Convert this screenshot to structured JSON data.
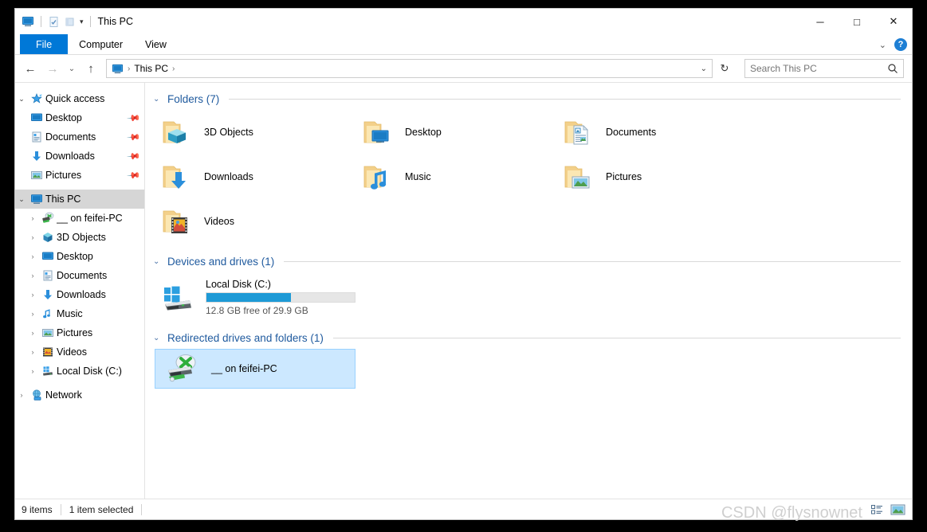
{
  "window": {
    "title": "This PC",
    "minimize_label": "─",
    "maximize_label": "□",
    "close_label": "✕"
  },
  "quick_access_toolbar": {
    "items": [
      {
        "name": "this-pc-icon",
        "label": ""
      },
      {
        "name": "properties-icon",
        "label": ""
      },
      {
        "name": "new-folder-icon",
        "label": ""
      },
      {
        "name": "customize-dropdown-icon",
        "label": "▾"
      }
    ]
  },
  "ribbon": {
    "tabs": [
      {
        "label": "File",
        "active": true
      },
      {
        "label": "Computer",
        "active": false
      },
      {
        "label": "View",
        "active": false
      }
    ],
    "collapse_label": "⌄",
    "help_label": "?"
  },
  "address_bar": {
    "back_label": "←",
    "forward_label": "→",
    "recent_label": "⌄",
    "up_label": "↑",
    "breadcrumb": [
      "This PC"
    ],
    "crumb_separator": "›",
    "dropdown_label": "⌄",
    "refresh_label": "↻"
  },
  "search": {
    "placeholder": "Search This PC",
    "value": "",
    "icon_label": "⌕"
  },
  "sidebar": {
    "groups": [
      {
        "label": "Quick access",
        "icon": "star-icon",
        "expanded": true,
        "chevron": "⌄",
        "items": [
          {
            "label": "Desktop",
            "icon": "monitor-icon",
            "pinned": true
          },
          {
            "label": "Documents",
            "icon": "document-icon",
            "pinned": true
          },
          {
            "label": "Downloads",
            "icon": "download-icon",
            "pinned": true
          },
          {
            "label": "Pictures",
            "icon": "picture-icon",
            "pinned": true
          }
        ]
      },
      {
        "label": "This PC",
        "icon": "monitor-icon",
        "expanded": true,
        "selected": true,
        "chevron": "⌄",
        "items": [
          {
            "label": "__ on feifei-PC",
            "icon": "network-drive-icon",
            "chevron": "›"
          },
          {
            "label": "3D Objects",
            "icon": "cube-icon",
            "chevron": "›"
          },
          {
            "label": "Desktop",
            "icon": "monitor-icon",
            "chevron": "›"
          },
          {
            "label": "Documents",
            "icon": "document-icon",
            "chevron": "›"
          },
          {
            "label": "Downloads",
            "icon": "download-icon",
            "chevron": "›"
          },
          {
            "label": "Music",
            "icon": "music-icon",
            "chevron": "›"
          },
          {
            "label": "Pictures",
            "icon": "picture-icon",
            "chevron": "›"
          },
          {
            "label": "Videos",
            "icon": "video-icon",
            "chevron": "›"
          },
          {
            "label": "Local Disk (C:)",
            "icon": "drive-icon",
            "chevron": "›"
          }
        ]
      },
      {
        "label": "Network",
        "icon": "network-icon",
        "expanded": false,
        "chevron": "›",
        "items": []
      }
    ]
  },
  "content": {
    "groups": [
      {
        "title": "Folders (7)",
        "chevron": "⌄"
      },
      {
        "title": "Devices and drives (1)",
        "chevron": "⌄"
      },
      {
        "title": "Redirected drives and folders (1)",
        "chevron": "⌄"
      }
    ],
    "folders": [
      {
        "label": "3D Objects",
        "icon": "folder-3d-objects-icon"
      },
      {
        "label": "Desktop",
        "icon": "folder-desktop-icon"
      },
      {
        "label": "Documents",
        "icon": "folder-documents-icon"
      },
      {
        "label": "Downloads",
        "icon": "folder-downloads-icon"
      },
      {
        "label": "Music",
        "icon": "folder-music-icon"
      },
      {
        "label": "Pictures",
        "icon": "folder-pictures-icon"
      },
      {
        "label": "Videos",
        "icon": "folder-videos-icon"
      }
    ],
    "drives": [
      {
        "label": "Local Disk (C:)",
        "icon": "windows-drive-icon",
        "free_text": "12.8 GB free of 29.9 GB",
        "used_percent": 57,
        "bar_color": "#1e9ad6"
      }
    ],
    "redirected": [
      {
        "label": "__ on feifei-PC",
        "icon": "network-drive-icon",
        "selected": true
      }
    ]
  },
  "status_bar": {
    "item_count": "9 items",
    "selection": "1 item selected"
  },
  "view_buttons": [
    {
      "name": "details-view-button",
      "label": ""
    },
    {
      "name": "large-icons-view-button",
      "label": ""
    }
  ],
  "watermark": "CSDN @flysnownet",
  "colors": {
    "accent": "#0078d7",
    "group_header": "#1f5a9e",
    "selection_fill": "#cce8ff",
    "selection_border": "#99d1ff",
    "drive_bar": "#1e9ad6"
  }
}
